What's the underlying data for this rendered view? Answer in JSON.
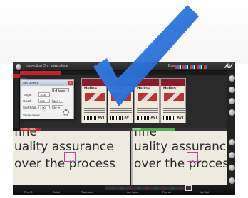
{
  "window": {
    "title": "Inspection On · www.alone",
    "mode_label": "Base",
    "brand": "AV"
  },
  "regions": {
    "top_tag": "Tellos",
    "split_left_tag": "Fonts Status",
    "split_right_tag": "Picture"
  },
  "cards": [
    {
      "logo": "Helios",
      "badge": "AVT"
    },
    {
      "logo": "Helios",
      "badge": "AVT"
    },
    {
      "logo": "Helios",
      "badge": "AVT"
    },
    {
      "logo": "Helios",
      "badge": "AVT"
    }
  ],
  "dialog": {
    "title": "Set Defect",
    "close_glyph": "✕",
    "apply_label": "Apply",
    "apply_checked": true,
    "rows": [
      {
        "label": "Target",
        "value": "1000",
        "value2": ""
      },
      {
        "label": "Good",
        "value": "500",
        "value2": "620 %"
      },
      {
        "label": "Sort Fault",
        "value": "1,00",
        "value2": "30 %"
      }
    ],
    "footer_label": "Show Label"
  },
  "magnified": {
    "lines": [
      "fine",
      "uality assurance",
      "over the process"
    ]
  },
  "bottom_bar": {
    "items": [
      "Print ID",
      "Rolled",
      "Total count",
      "Job Name",
      "Print art",
      "Job Stat"
    ]
  },
  "colors": {
    "accent_red": "#c81f2a",
    "accent_green": "#4caf50",
    "checkmark_blue": "#1f6fd6",
    "marker_magenta": "#b04aa8"
  },
  "icons": {
    "checkmark": "large-checkmark-icon",
    "close": "close-icon",
    "gear": "gear-icon"
  }
}
